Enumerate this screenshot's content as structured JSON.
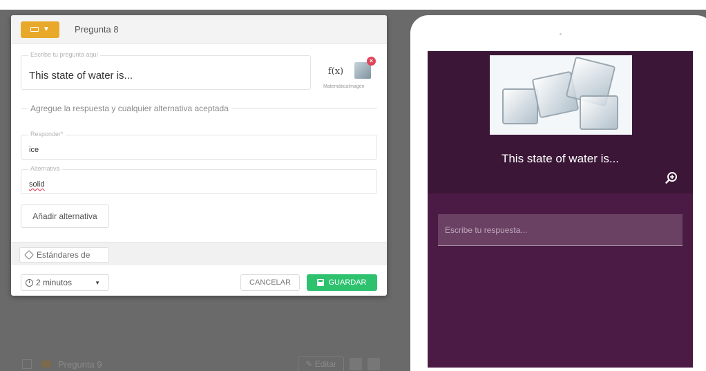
{
  "editor": {
    "question_title": "Pregunta 8",
    "question_field": {
      "label": "Escribe tu pregunta aquí",
      "value": "This state of water is..."
    },
    "tools": {
      "math_symbol": "f(x)",
      "math_label": "Matemática",
      "image_label": "Imagen",
      "remove_image_symbol": "×"
    },
    "answers_divider": "Agregue la respuesta y cualquier alternativa aceptada",
    "answer_field": {
      "label": "Responder*",
      "value": "ice"
    },
    "alternative_field": {
      "label": "Alternativa",
      "value": "solid"
    },
    "add_alternative_label": "Añadir alternativa",
    "standards_label": "Estándares de",
    "time_select": "2 minutos",
    "cancel_label": "CANCELAR",
    "save_label": "GUARDAR"
  },
  "background_row": {
    "question_title": "Pregunta 9",
    "edit_label": "Editar"
  },
  "preview": {
    "question_text": "This state of water is...",
    "answer_placeholder": "Escribe tu respuesta..."
  },
  "colors": {
    "accent_orange": "#e8a92b",
    "save_green": "#2ec26f",
    "preview_purple": "#4b1a45",
    "preview_purple_dark": "#3b1637"
  }
}
